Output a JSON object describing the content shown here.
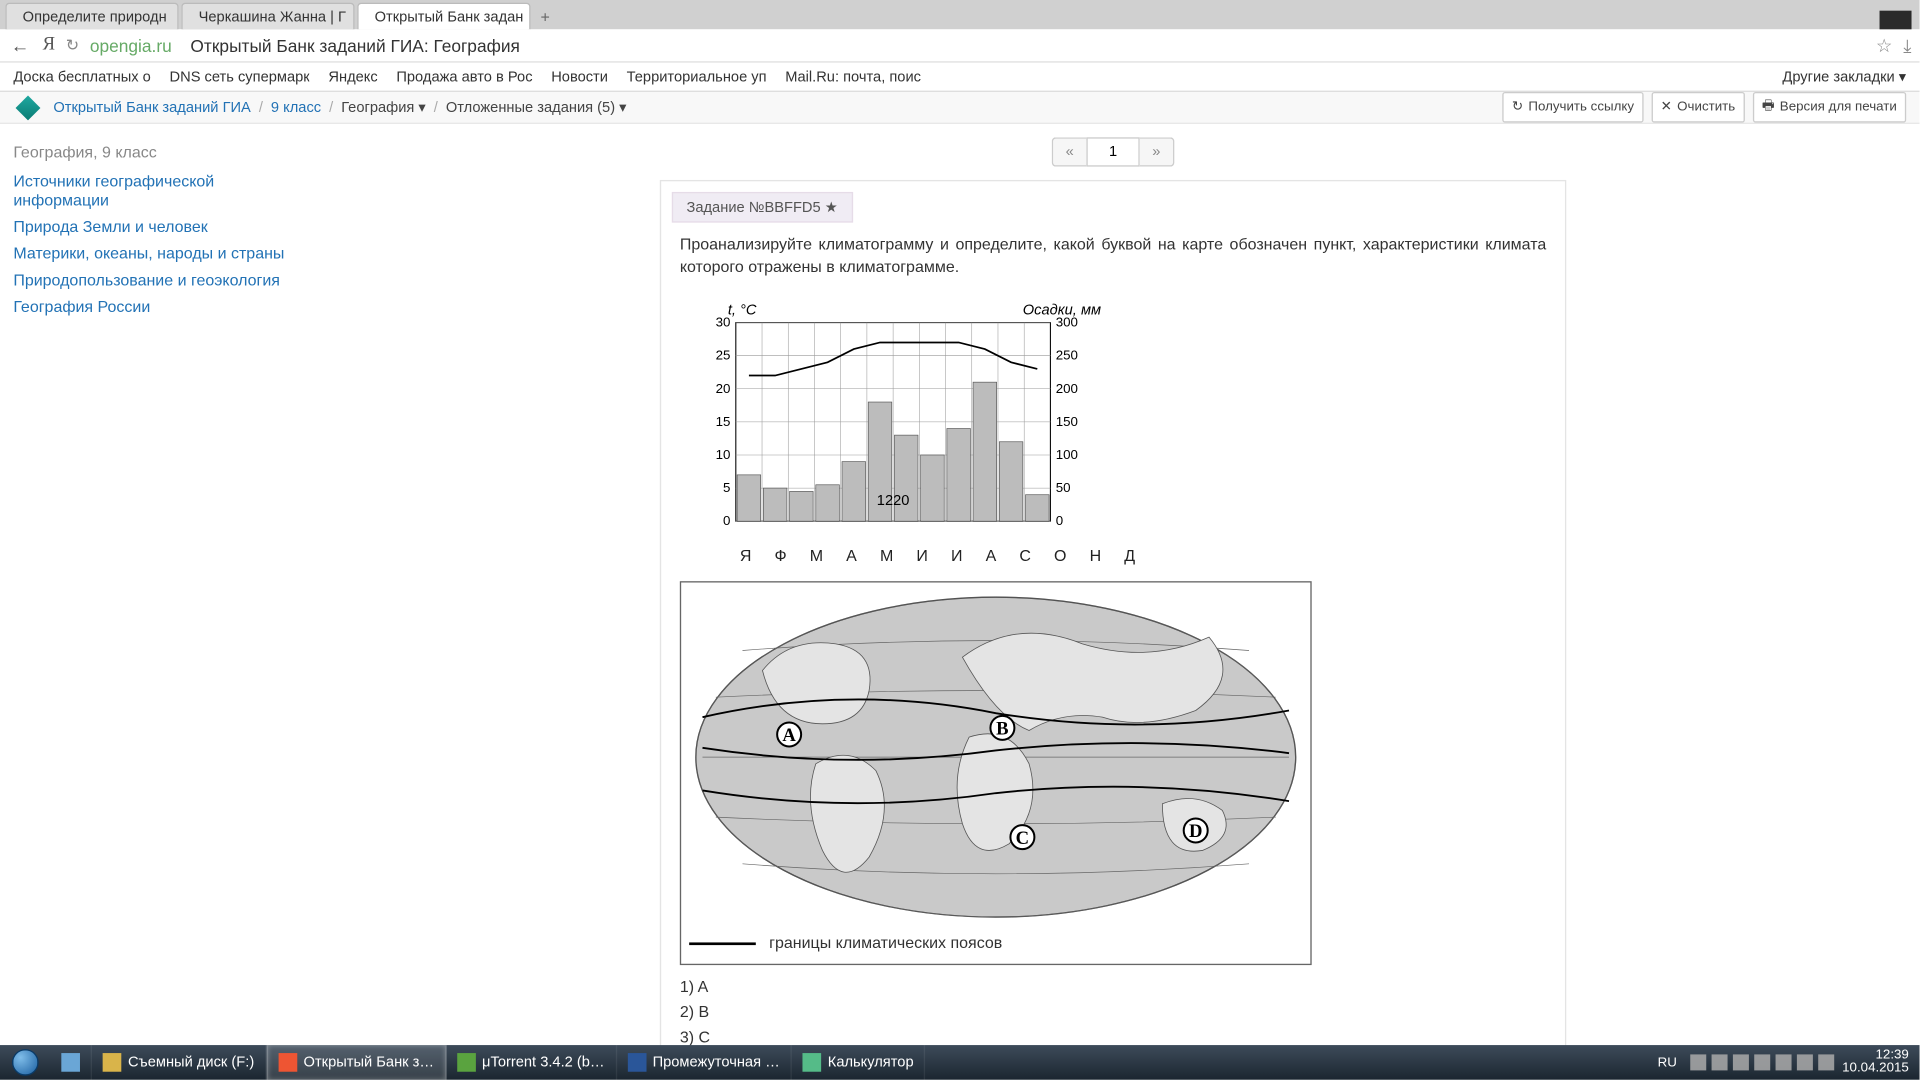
{
  "window": {
    "tabs": [
      {
        "label": "Определите природн",
        "close": "×"
      },
      {
        "label": "Черкашина Жанна | Г",
        "close": "×"
      },
      {
        "label": "Открытый Банк задан",
        "close": "×"
      }
    ],
    "newtab": "+"
  },
  "addressbar": {
    "back": "←",
    "yandex": "Я",
    "reload": "↻",
    "host": "opengia.ru",
    "title": "Открытый Банк заданий ГИА: География",
    "star": "☆",
    "download": "⤓"
  },
  "bookmarks": {
    "items": [
      "Доска бесплатных о",
      "DNS сеть супермарк",
      "Яндекс",
      "Продажа авто в Рос",
      "Новости",
      "Территориальное уп",
      "Mail.Ru: почта, поис"
    ],
    "other": "Другие закладки ▾"
  },
  "page_header": {
    "crumbs": [
      "Открытый Банк заданий ГИА",
      "9 класс",
      "География ▾",
      "Отложенные задания (5) ▾"
    ],
    "actions": [
      {
        "icon": "↻",
        "label": "Получить ссылку"
      },
      {
        "icon": "✕",
        "label": "Очистить"
      },
      {
        "icon": "🖶",
        "label": "Версия для печати"
      }
    ]
  },
  "sidebar": {
    "title": "География, 9 класс",
    "links": [
      "Источники географической информации",
      "Природа Земли и человек",
      "Материки, океаны, народы и страны",
      "Природопользование и геоэкология",
      "География России"
    ]
  },
  "pager": {
    "prev": "«",
    "value": "1",
    "next": "»"
  },
  "task": {
    "header_label": "Задание №BBFFD5 ★",
    "text": "Проанализируйте климатограмму и определите, какой буквой на карте обозначен пункт, характеристики климата которого отражены в климатограмме.",
    "answers": [
      "1)   A",
      "2)   B",
      "3)   C"
    ]
  },
  "chart_data": {
    "type": "bar",
    "title_left": "t, °C",
    "title_right": "Осадки, мм",
    "categories": [
      "Я",
      "Ф",
      "М",
      "А",
      "М",
      "И",
      "И",
      "А",
      "С",
      "О",
      "Н",
      "Д"
    ],
    "y_left_ticks": [
      0,
      5,
      10,
      15,
      20,
      25,
      30
    ],
    "y_right_ticks": [
      0,
      50,
      100,
      150,
      200,
      250,
      300
    ],
    "precip_mm": [
      70,
      50,
      45,
      55,
      90,
      180,
      130,
      100,
      140,
      210,
      120,
      40
    ],
    "temp_c": [
      22,
      22,
      23,
      24,
      26,
      27,
      27,
      27,
      27,
      26,
      24,
      23
    ],
    "annotation": "1220",
    "ylim_left": [
      0,
      30
    ],
    "ylim_right": [
      0,
      300
    ]
  },
  "map": {
    "points": [
      "A",
      "B",
      "C",
      "D"
    ],
    "legend": "границы климатических поясов"
  },
  "taskbar": {
    "items": [
      {
        "label": "Съемный диск (F:)",
        "icon": "ic-folder"
      },
      {
        "label": "Открытый Банк з…",
        "icon": "ic-y",
        "active": true
      },
      {
        "label": "μTorrent 3.4.2  (b…",
        "icon": "ic-ut"
      },
      {
        "label": "Промежуточная …",
        "icon": "ic-w"
      },
      {
        "label": "Калькулятор",
        "icon": "ic-calc"
      }
    ],
    "lang": "RU",
    "time": "12:39",
    "date": "10.04.2015"
  }
}
